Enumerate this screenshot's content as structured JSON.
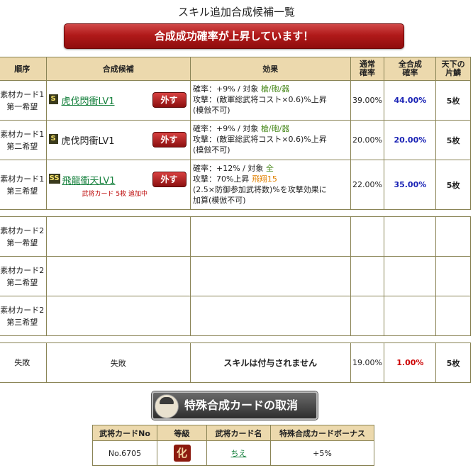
{
  "page": {
    "title": "スキル追加合成候補一覧",
    "banner": "合成成功確率が上昇しています！"
  },
  "table": {
    "headers": {
      "order": "順序",
      "candidate": "合成候補",
      "effect": "効果",
      "normal_rate_1": "通常",
      "normal_rate_2": "確率",
      "total_rate_1": "全合成",
      "total_rate_2": "確率",
      "tenka_1": "天下の",
      "tenka_2": "片鱗"
    },
    "rows": [
      {
        "order_1": "素材カード1",
        "order_2": "第一希望",
        "rank": "S",
        "name": "虎伐閃衝LV1",
        "remove": "外す",
        "eff_1_pre": "確率：+9% / 対象 ",
        "eff_1_target": "槍/砲/器",
        "eff_2": "攻撃：(敵軍総武将コスト×0.6)%上昇",
        "eff_3": "(模倣不可)",
        "normal": "39.00%",
        "total": "44.00%",
        "count": "5枚"
      },
      {
        "order_1": "素材カード1",
        "order_2": "第二希望",
        "rank": "S",
        "name": "虎伐閃衝LV1",
        "remove": "外す",
        "eff_1_pre": "確率：+9% / 対象 ",
        "eff_1_target": "槍/砲/器",
        "eff_2": "攻撃：(敵軍総武将コスト×0.6)%上昇",
        "eff_3": "(模倣不可)",
        "normal": "20.00%",
        "total": "20.00%",
        "count": "5枚"
      },
      {
        "order_1": "素材カード1",
        "order_2": "第三希望",
        "rank": "SS",
        "name": "飛龍衝天LV1",
        "remove": "外す",
        "note": "武将カード 5枚 追加中",
        "eff_1_pre": "確率：+12% / 対象 ",
        "eff_1_target": "全",
        "eff_2_pre": "攻撃：70%上昇 ",
        "eff_2_extra": "飛翔15",
        "eff_3": "(2.5×防御参加武将数)%を攻撃効果に",
        "eff_4": "加算(模倣不可)",
        "normal": "22.00%",
        "total": "35.00%",
        "count": "5枚"
      }
    ],
    "empty_rows": [
      {
        "order_1": "素材カード2",
        "order_2": "第一希望"
      },
      {
        "order_1": "素材カード2",
        "order_2": "第二希望"
      },
      {
        "order_1": "素材カード2",
        "order_2": "第三希望"
      }
    ],
    "fail": {
      "order": "失敗",
      "candidate": "失敗",
      "effect": "スキルは付与されません",
      "normal": "19.00%",
      "total": "1.00%",
      "count": "5枚"
    }
  },
  "cancel_button": {
    "label": "特殊合成カードの取消"
  },
  "special": {
    "headers": [
      "武将カードNo",
      "等級",
      "武将カード名",
      "特殊合成カードボーナス"
    ],
    "row": {
      "no": "No.6705",
      "grade": "化",
      "name": "ちえ",
      "bonus": "+5%"
    }
  }
}
